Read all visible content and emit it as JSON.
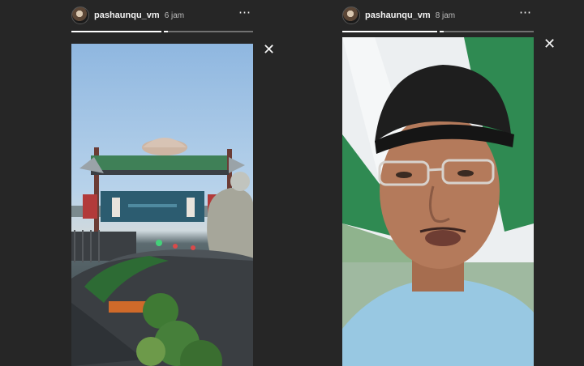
{
  "stories": [
    {
      "username": "pashaunqu_vm",
      "time": "6 jam",
      "more_icon": "more-horizontal-icon",
      "close_icon": "close-icon",
      "progress": [
        1.0,
        0.05
      ],
      "media_icon": "outdoor-stage-photo"
    },
    {
      "username": "pashaunqu_vm",
      "time": "8 jam",
      "more_icon": "more-horizontal-icon",
      "close_icon": "close-icon",
      "progress": [
        1.0,
        0.05
      ],
      "media_icon": "selfie-video-photo"
    }
  ],
  "icons": {
    "more": "⋯",
    "close": "✕"
  }
}
